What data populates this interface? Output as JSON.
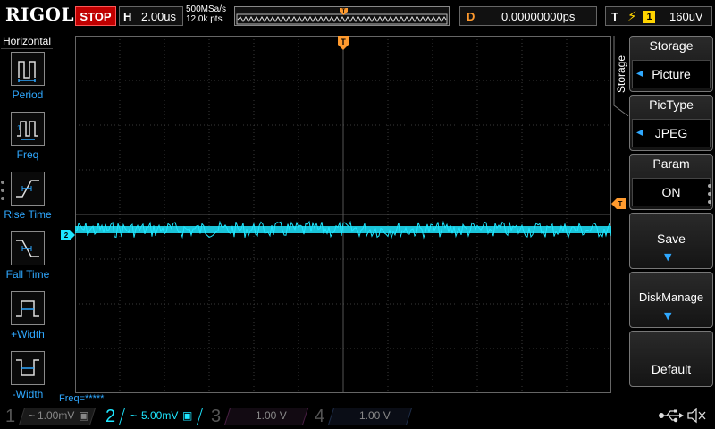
{
  "top": {
    "brand": "RIGOL",
    "run_state": "STOP",
    "horizontal_label": "H",
    "timebase": "2.00us",
    "sample_rate": "500MSa/s",
    "memory_depth": "12.0k pts",
    "delay_label": "D",
    "delay_value": "0.00000000ps",
    "trigger_label": "T",
    "trigger_source": "1",
    "trigger_level": "160uV",
    "colors": {
      "stop": "#c00000",
      "trigger": "#ffd400",
      "delay": "#ff9a2e"
    }
  },
  "left_menu": {
    "title": "Horizontal",
    "items": [
      {
        "label": "Period",
        "icon": "period-icon"
      },
      {
        "label": "Freq",
        "icon": "frequency-icon"
      },
      {
        "label": "Rise Time",
        "icon": "rise-time-icon"
      },
      {
        "label": "Fall Time",
        "icon": "fall-time-icon"
      },
      {
        "label": "+Width",
        "icon": "positive-width-icon"
      },
      {
        "label": "-Width",
        "icon": "negative-width-icon"
      }
    ]
  },
  "display": {
    "trigger_position_marker": "T",
    "channel_marker": "2",
    "freq_readout": "Freq=*****",
    "trace_color": "#1ee6ff"
  },
  "right_menu": {
    "side_label": "Storage",
    "buttons": [
      {
        "title": "Storage",
        "value": "Picture"
      },
      {
        "title": "PicType",
        "value": "JPEG"
      },
      {
        "title": "Param",
        "value": "ON"
      },
      {
        "title": "Save"
      },
      {
        "title": "DiskManage"
      },
      {
        "title": "Default"
      }
    ]
  },
  "channels": [
    {
      "num": "1",
      "coupling": "~",
      "scale": "1.00mV",
      "color": "#ffd400",
      "active": false
    },
    {
      "num": "2",
      "coupling": "~",
      "scale": "5.00mV",
      "color": "#1ee6ff",
      "active": true
    },
    {
      "num": "3",
      "coupling": "",
      "scale": "1.00 V",
      "color": "#e040c0",
      "active": false
    },
    {
      "num": "4",
      "coupling": "",
      "scale": "1.00 V",
      "color": "#2f6bff",
      "active": false
    }
  ],
  "status_icons": [
    "usb-icon",
    "speaker-mute-icon"
  ]
}
